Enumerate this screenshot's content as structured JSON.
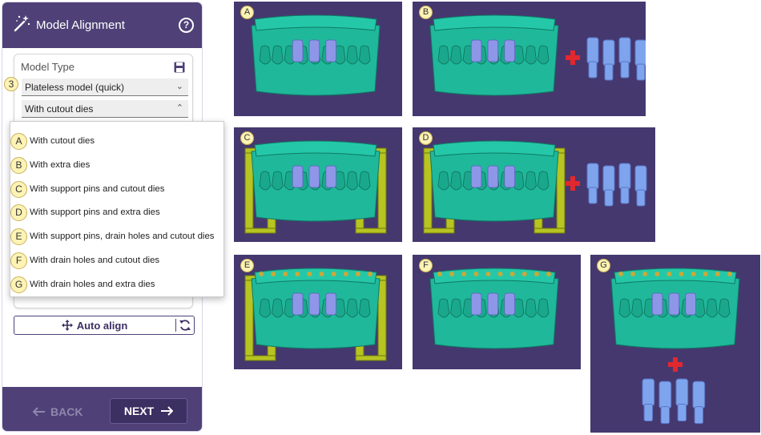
{
  "sidebar": {
    "title": "Model Alignment",
    "help_icon": "question-circle-icon",
    "card": {
      "heading": "Model Type",
      "step_badge": "3",
      "model_type_value": "Plateless model (quick)",
      "die_option_value": "With cutout dies"
    },
    "dropdown_options": [
      {
        "badge": "A",
        "label": "With cutout dies"
      },
      {
        "badge": "B",
        "label": "With extra dies"
      },
      {
        "badge": "C",
        "label": "With support pins and cutout dies"
      },
      {
        "badge": "D",
        "label": "With support pins and extra dies"
      },
      {
        "badge": "E",
        "label": "With support pins, drain holes and cutout dies"
      },
      {
        "badge": "F",
        "label": "With drain holes and cutout dies"
      },
      {
        "badge": "G",
        "label": "With drain holes and extra dies"
      }
    ],
    "auto_align_label": "Auto align",
    "back_label": "BACK",
    "next_label": "NEXT"
  },
  "panels": [
    {
      "tag": "A",
      "pins": false,
      "extra_dies": false,
      "drain_holes": false
    },
    {
      "tag": "B",
      "pins": false,
      "extra_dies": true,
      "drain_holes": false
    },
    {
      "tag": "C",
      "pins": true,
      "extra_dies": false,
      "drain_holes": false
    },
    {
      "tag": "D",
      "pins": true,
      "extra_dies": true,
      "drain_holes": false
    },
    {
      "tag": "E",
      "pins": true,
      "extra_dies": false,
      "drain_holes": true
    },
    {
      "tag": "F",
      "pins": false,
      "extra_dies": false,
      "drain_holes": true
    },
    {
      "tag": "G",
      "pins": false,
      "extra_dies": true,
      "drain_holes": true
    }
  ],
  "colors": {
    "panel_bg": "#45386f",
    "model": "#1fb89a",
    "dies": "#8e96e8",
    "extra_dies": "#7fa4ee",
    "pins": "#b7c421",
    "plus": "#e0282e",
    "header": "#4f4177",
    "badge": "#fdf3b4"
  }
}
